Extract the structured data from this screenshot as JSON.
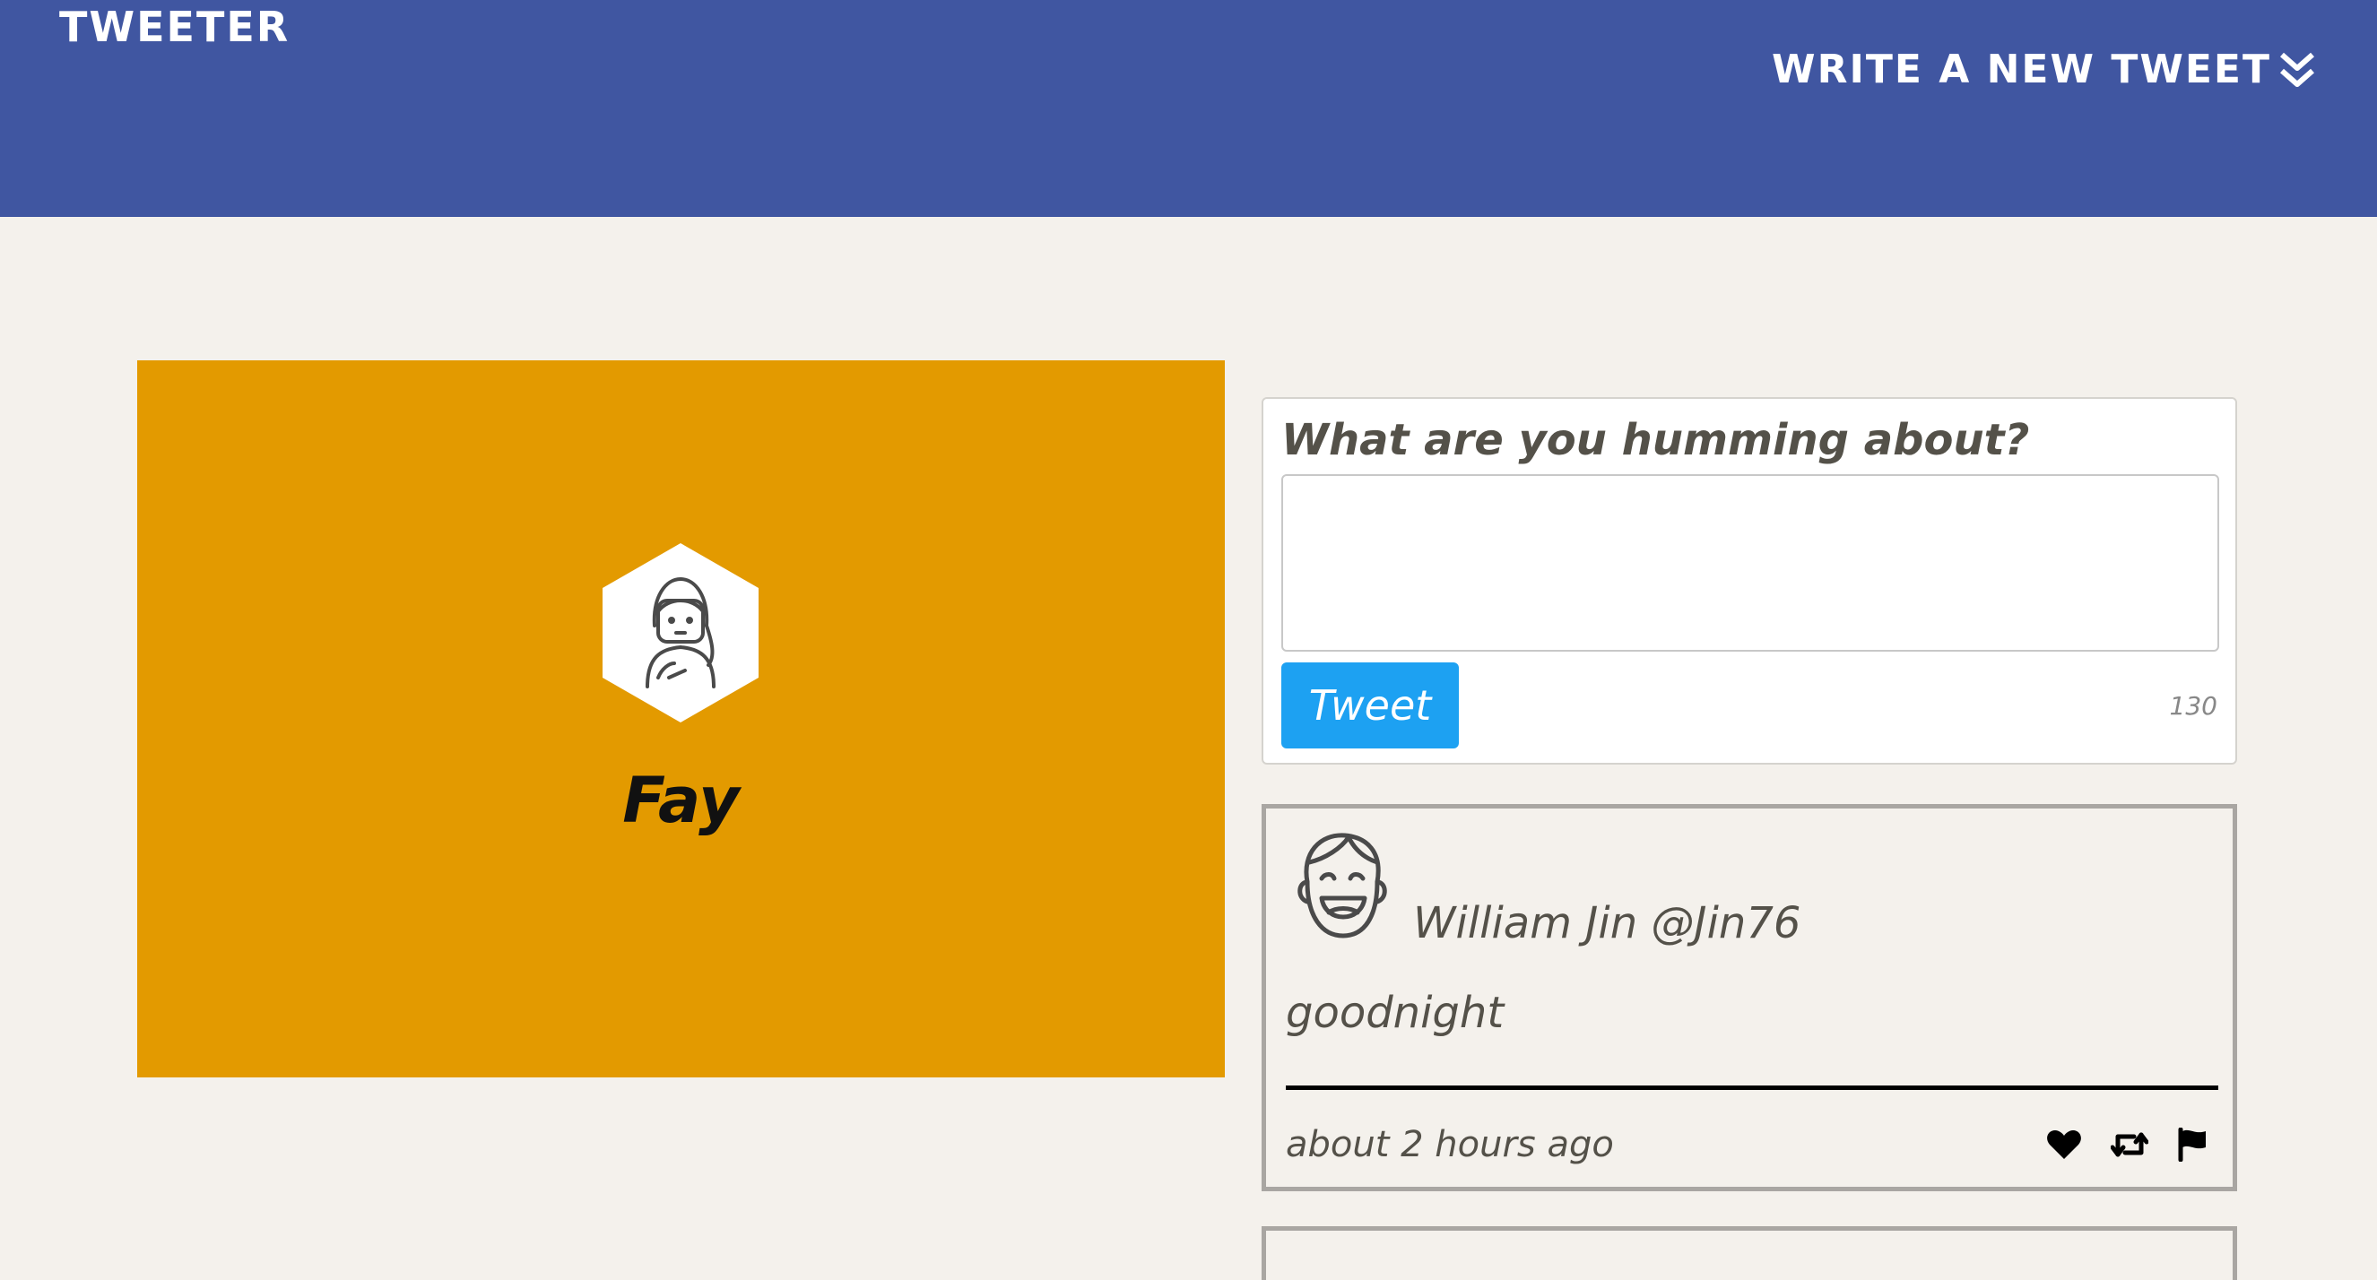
{
  "nav": {
    "brand": "TWEETER",
    "compose_label": "WRITE A NEW TWEET",
    "compose_icon": "double-chevron-down-icon"
  },
  "profile": {
    "name": "Fay",
    "avatar_icon": "woman-avatar-icon",
    "background_color": "#e39a00"
  },
  "composer": {
    "prompt": "What are you humming about?",
    "input_value": "",
    "submit_label": "Tweet",
    "char_counter": "130"
  },
  "tweets": [
    {
      "author": "William Jin @Jin76",
      "body": "goodnight",
      "time": "about 2 hours ago",
      "avatar_icon": "laughing-man-avatar-icon",
      "actions": [
        "heart-icon",
        "retweet-icon",
        "flag-icon"
      ]
    }
  ],
  "colors": {
    "nav_bg": "#4056a1",
    "page_bg": "#f4f1ec",
    "button_bg": "#1da1f2",
    "text": "#545149"
  }
}
